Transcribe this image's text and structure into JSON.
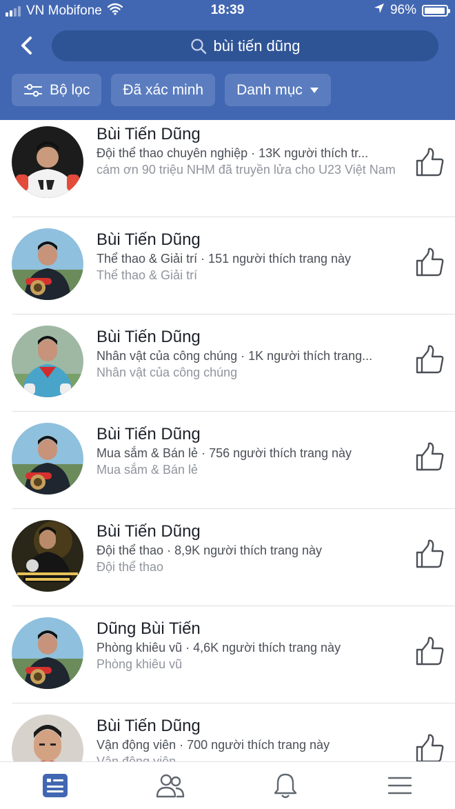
{
  "status_bar": {
    "carrier": "VN Mobifone",
    "time": "18:39",
    "battery": "96%",
    "battery_level": 0.96,
    "signal_bars": 2
  },
  "search": {
    "query": "bùi tiến dũng",
    "icons": {
      "back": "chevron-left-icon",
      "search": "magnifier-icon"
    }
  },
  "filters": [
    {
      "label": "Bộ lọc",
      "icon": "sliders-icon"
    },
    {
      "label": "Đã xác minh"
    },
    {
      "label": "Danh mục",
      "icon": "caret-down-icon"
    }
  ],
  "results": [
    {
      "name": "Bùi Tiến Dũng",
      "meta": "Đội thể thao chuyên nghiệp · 13K người thích tr...",
      "sub": "cám ơn 90 triệu NHM đã truyền lửa cho U23 Việt Nam",
      "avatar": "white-shirt"
    },
    {
      "name": "Bùi Tiến Dũng",
      "meta": "Thể thao & Giải trí · 151 người thích trang này",
      "sub": "Thể thao & Giải trí",
      "avatar": "keeper-dark"
    },
    {
      "name": "Bùi Tiến Dũng",
      "meta": "Nhân vật của công chúng · 1K người thích trang...",
      "sub": "Nhân vật của công chúng",
      "avatar": "keeper-blue"
    },
    {
      "name": "Bùi Tiến Dũng",
      "meta": "Mua sắm & Bán lẻ · 756 người thích trang này",
      "sub": "Mua sắm & Bán lẻ",
      "avatar": "keeper-dark"
    },
    {
      "name": "Bùi Tiến Dũng",
      "meta": "Đội thể thao · 8,9K người thích trang này",
      "sub": "Đội thể thao",
      "avatar": "poster"
    },
    {
      "name": "Dũng Bùi Tiến",
      "meta": "Phòng khiêu vũ · 4,6K người thích trang này",
      "sub": "Phòng khiêu vũ",
      "avatar": "keeper-dark"
    },
    {
      "name": "Bùi Tiến Dũng",
      "meta": "Vận động viên · 700 người thích trang này",
      "sub": "Vận động viên",
      "avatar": "red-shirt"
    }
  ],
  "tabs": [
    {
      "name": "news-feed",
      "icon": "news-feed-icon",
      "active": true
    },
    {
      "name": "friends",
      "icon": "friends-icon",
      "active": false
    },
    {
      "name": "notifications",
      "icon": "bell-icon",
      "active": false
    },
    {
      "name": "menu",
      "icon": "hamburger-menu-icon",
      "active": false
    }
  ],
  "colors": {
    "brand": "#4267b2",
    "search_bg": "#2f5496",
    "chip_bg": "#5b7dc0",
    "active_tab": "#4267b2",
    "inactive_tab": "#606770"
  }
}
